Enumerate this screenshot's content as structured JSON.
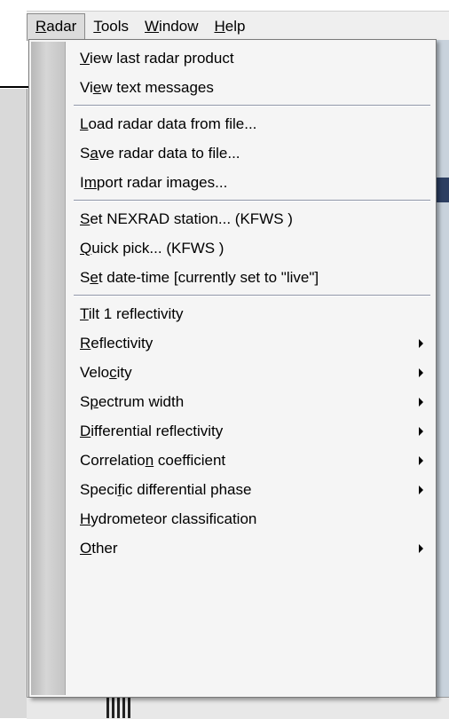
{
  "menubar": {
    "items": [
      {
        "label": "Radar",
        "accel": "R"
      },
      {
        "label": "Tools",
        "accel": "T"
      },
      {
        "label": "Window",
        "accel": "W"
      },
      {
        "label": "Help",
        "accel": "H"
      }
    ]
  },
  "menu": {
    "groups": [
      [
        {
          "pre": "",
          "acc": "V",
          "post": "iew last radar product",
          "submenu": false
        },
        {
          "pre": "Vi",
          "acc": "e",
          "post": "w text messages",
          "submenu": false
        }
      ],
      [
        {
          "pre": "",
          "acc": "L",
          "post": "oad radar data from file...",
          "submenu": false
        },
        {
          "pre": "S",
          "acc": "a",
          "post": "ve radar data to file...",
          "submenu": false
        },
        {
          "pre": "I",
          "acc": "m",
          "post": "port radar images...",
          "submenu": false
        }
      ],
      [
        {
          "pre": "",
          "acc": "S",
          "post": "et NEXRAD station... (KFWS )",
          "submenu": false
        },
        {
          "pre": "",
          "acc": "Q",
          "post": "uick pick... (KFWS )",
          "submenu": false
        },
        {
          "pre": "S",
          "acc": "e",
          "post": "t date-time [currently set to \"live\"]",
          "submenu": false
        }
      ],
      [
        {
          "pre": "",
          "acc": "T",
          "post": "ilt 1 reflectivity",
          "submenu": false
        },
        {
          "pre": "",
          "acc": "R",
          "post": "eflectivity",
          "submenu": true
        },
        {
          "pre": "Velo",
          "acc": "c",
          "post": "ity",
          "submenu": true
        },
        {
          "pre": "S",
          "acc": "p",
          "post": "ectrum width",
          "submenu": true
        },
        {
          "pre": "",
          "acc": "D",
          "post": "ifferential reflectivity",
          "submenu": true
        },
        {
          "pre": "Correlatio",
          "acc": "n",
          "post": " coefficient",
          "submenu": true
        },
        {
          "pre": "Speci",
          "acc": "f",
          "post": "ic differential phase",
          "submenu": true
        },
        {
          "pre": "",
          "acc": "H",
          "post": "ydrometeor classification",
          "submenu": false
        },
        {
          "pre": "",
          "acc": "O",
          "post": "ther",
          "submenu": true
        }
      ]
    ]
  }
}
